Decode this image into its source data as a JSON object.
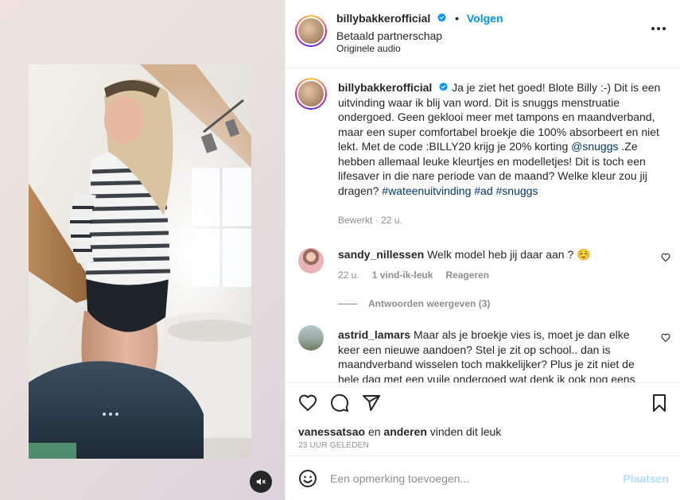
{
  "header": {
    "username": "billybakkerofficial",
    "follow_label": "Volgen",
    "partnership": "Betaald partnerschap",
    "audio": "Originele audio"
  },
  "caption": {
    "username": "billybakkerofficial",
    "text_part1": "Ja je ziet het goed! Blote Billy :-) Dit is een uitvinding waar ik blij van word. Dit is snuggs menstruatie ondergoed. Geen geklooi meer met tampons en maandverband, maar een super comfortabel broekje die 100% absorbeert en niet lekt. Met de code :BILLY20 krijg je 20% korting ",
    "mention": "@snuggs",
    "text_part2": " .Ze hebben allemaal leuke kleurtjes en modelletjes! Dit is toch een lifesaver in die nare periode van de maand? Welke kleur zou jij dragen? ",
    "hashtag1": "#wateenuitvinding",
    "hashtag2": "#ad",
    "hashtag3": "#snuggs",
    "edited": "Bewerkt",
    "time": "22 u."
  },
  "comments": [
    {
      "username": "sandy_nillessen",
      "text": "Welk model heb jij daar aan ? ☺️",
      "time": "22 u.",
      "likes": "1 vind-ik-leuk",
      "reply": "Reageren",
      "view_replies": "Antwoorden weergeven (3)"
    },
    {
      "username": "astrid_lamars",
      "text": "Maar als je broekje vies is, moet je dan elke keer een nieuwe aandoen? Stel je zit op school.. dan is maandverband wisselen toch makkelijker? Plus je zit niet de hele dag met een vuile ondergoed wat denk ik ook nog eens"
    }
  ],
  "likes": {
    "user": "vanessatsao",
    "connector": "en",
    "others": "anderen",
    "suffix": "vinden dit leuk",
    "time": "23 UUR GELEDEN"
  },
  "add_comment": {
    "placeholder": "Een opmerking toevoegen...",
    "post_label": "Plaatsen"
  },
  "colors": {
    "accent": "#0095f6",
    "link": "#00376b",
    "muted": "#8e8e8e",
    "post_disabled": "#b2dffc"
  },
  "icons": [
    "verified-badge-icon",
    "more-options-icon",
    "heart-icon",
    "comment-icon",
    "share-icon",
    "bookmark-icon",
    "emoji-icon",
    "mute-icon"
  ]
}
